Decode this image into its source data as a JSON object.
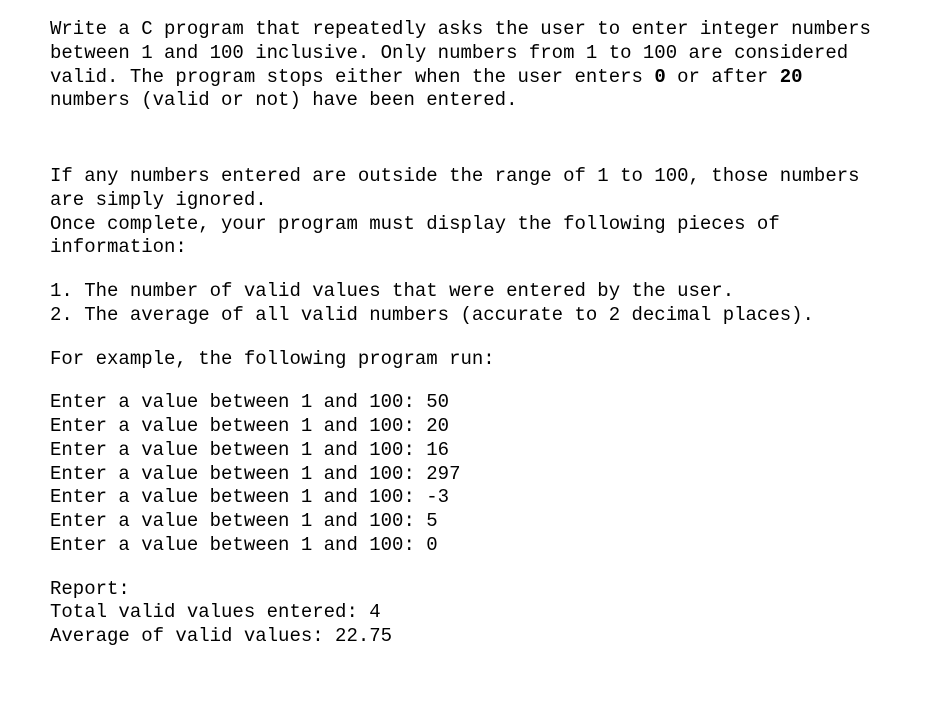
{
  "intro": {
    "text_before_zero": "Write a C program that repeatedly asks the user to enter integer numbers between 1 and 100 inclusive. Only numbers from 1 to 100 are considered valid. The program stops either when the user enters ",
    "bold_zero": "0",
    "text_mid": " or after ",
    "bold_twenty": "20",
    "text_after_twenty": " numbers (valid or not) have been entered."
  },
  "ignore_text": "If any numbers entered are outside the range of 1 to 100, those numbers are simply ignored.",
  "once_complete": "Once complete, your program must display the following pieces of information:",
  "req1": "1. The number of valid values that were entered by the user.",
  "req2": "2. The average of all valid numbers (accurate to 2 decimal places).",
  "example_heading": "For example, the following program run:",
  "sample_run": [
    "Enter a value between 1 and 100: 50",
    "Enter a value between 1 and 100: 20",
    "Enter a value between 1 and 100: 16",
    "Enter a value between 1 and 100: 297",
    "Enter a value between 1 and 100: -3",
    "Enter a value between 1 and 100: 5",
    "Enter a value between 1 and 100: 0"
  ],
  "report_heading": "Report:",
  "report_total": "Total valid values entered: 4",
  "report_avg": "Average of valid values: 22.75"
}
